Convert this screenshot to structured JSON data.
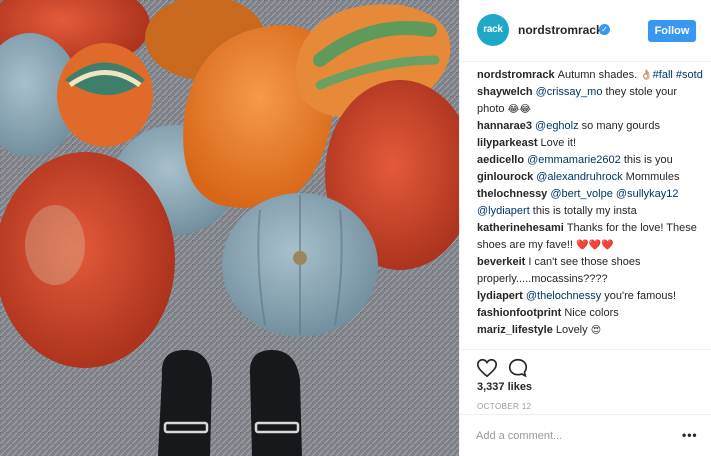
{
  "post": {
    "username": "nordstromrack",
    "avatar_text": "rack",
    "verified_mark": "✓",
    "follow_label": "Follow",
    "comments": [
      {
        "author": "nordstromrack",
        "segments": [
          {
            "t": "text",
            "v": "Autumn shades. "
          },
          {
            "t": "emoji",
            "v": "👌🏼"
          },
          {
            "t": "hashtag",
            "v": "#fall"
          },
          {
            "t": "text",
            "v": " "
          },
          {
            "t": "hashtag",
            "v": "#sotd"
          }
        ]
      },
      {
        "author": "shaywelch",
        "segments": [
          {
            "t": "mention",
            "v": "@crissay_mo"
          },
          {
            "t": "text",
            "v": " they stole your photo "
          },
          {
            "t": "emoji",
            "v": "😂😂"
          }
        ]
      },
      {
        "author": "hannarae3",
        "segments": [
          {
            "t": "mention",
            "v": "@egholz"
          },
          {
            "t": "text",
            "v": " so many gourds"
          }
        ]
      },
      {
        "author": "lilyparkeast",
        "segments": [
          {
            "t": "text",
            "v": "Love it!"
          }
        ]
      },
      {
        "author": "aedicello",
        "segments": [
          {
            "t": "mention",
            "v": "@emmamarie2602"
          },
          {
            "t": "text",
            "v": " this is you"
          }
        ]
      },
      {
        "author": "ginlourock",
        "segments": [
          {
            "t": "mention",
            "v": "@alexandruhrock"
          },
          {
            "t": "text",
            "v": " Mommules"
          }
        ]
      },
      {
        "author": "thelochnessy",
        "segments": [
          {
            "t": "mention",
            "v": "@bert_volpe"
          },
          {
            "t": "text",
            "v": " "
          },
          {
            "t": "mention",
            "v": "@sullykay12"
          },
          {
            "t": "text",
            "v": " "
          },
          {
            "t": "mention",
            "v": "@lydiapert"
          },
          {
            "t": "text",
            "v": " this is totally my insta"
          }
        ]
      },
      {
        "author": "katherinehesami",
        "segments": [
          {
            "t": "text",
            "v": "Thanks for the love! These shoes are my fave!! "
          },
          {
            "t": "emoji",
            "v": "❤️❤️❤️"
          }
        ]
      },
      {
        "author": "beverkeit",
        "segments": [
          {
            "t": "text",
            "v": "I can't see those shoes properly.....mocassins????"
          }
        ]
      },
      {
        "author": "lydiapert",
        "segments": [
          {
            "t": "mention",
            "v": "@thelochnessy"
          },
          {
            "t": "text",
            "v": " you're famous!"
          }
        ]
      },
      {
        "author": "fashionfootprint",
        "segments": [
          {
            "t": "text",
            "v": "Nice colors"
          }
        ]
      },
      {
        "author": "mariz_lifestyle",
        "segments": [
          {
            "t": "text",
            "v": "Lovely "
          },
          {
            "t": "emoji",
            "v": "😍"
          }
        ]
      }
    ],
    "likes": "3,337 likes",
    "date": "OCTOBER 12",
    "comment_placeholder": "Add a comment...",
    "more_glyph": "•••"
  },
  "icons": {
    "like": "heart-icon",
    "comment": "comment-bubble-icon",
    "more": "more-options-icon",
    "verified": "verified-badge-icon"
  },
  "colors": {
    "follow": "#3897f0",
    "avatar": "#1ea8c8",
    "link": "#003569",
    "muted": "#999999"
  }
}
